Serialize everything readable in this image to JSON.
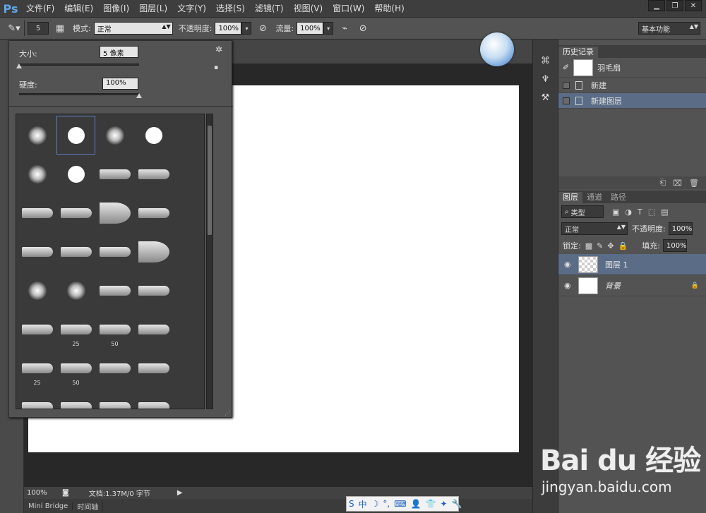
{
  "app": {
    "logo": "Ps"
  },
  "menu": [
    "文件(F)",
    "编辑(E)",
    "图像(I)",
    "图层(L)",
    "文字(Y)",
    "选择(S)",
    "滤镜(T)",
    "视图(V)",
    "窗口(W)",
    "帮助(H)"
  ],
  "window_controls": [
    "▁",
    "❐",
    "✕"
  ],
  "options_bar": {
    "brush_size": "5",
    "mode_label": "模式:",
    "mode_value": "正常",
    "opacity_label": "不透明度:",
    "opacity_value": "100%",
    "flow_label": "流量:",
    "flow_value": "100%",
    "workspace": "基本功能"
  },
  "brush_picker": {
    "size_label": "大小:",
    "size_value": "5 像素",
    "hardness_label": "硬度:",
    "hardness_value": "100%",
    "size_level": 0.0,
    "hardness_level": 1.0,
    "brushes": [
      {
        "kind": "soft"
      },
      {
        "kind": "hard",
        "selected": true
      },
      {
        "kind": "soft"
      },
      {
        "kind": "hard"
      },
      {
        "kind": "soft"
      },
      {
        "kind": "hard"
      },
      {
        "kind": "tip"
      },
      {
        "kind": "flat"
      },
      {
        "kind": "flat"
      },
      {
        "kind": "flat"
      },
      {
        "kind": "fan"
      },
      {
        "kind": "flat"
      },
      {
        "kind": "flat"
      },
      {
        "kind": "flat"
      },
      {
        "kind": "flat"
      },
      {
        "kind": "fan"
      },
      {
        "kind": "soft"
      },
      {
        "kind": "soft"
      },
      {
        "kind": "flat"
      },
      {
        "kind": "flat"
      },
      {
        "kind": "pencil"
      },
      {
        "kind": "pencil",
        "number": "25"
      },
      {
        "kind": "airbrush",
        "number": "50"
      },
      {
        "kind": "airbrush"
      },
      {
        "kind": "airbrush",
        "number": "25"
      },
      {
        "kind": "airbrush",
        "number": "50"
      },
      {
        "kind": "airbrush"
      },
      {
        "kind": "airbrush"
      },
      {
        "kind": "airbrush"
      },
      {
        "kind": "airbrush"
      },
      {
        "kind": "flat"
      },
      {
        "kind": "airbrush"
      }
    ]
  },
  "history_panel": {
    "tab": "历史记录",
    "snapshot": "羽毛扇",
    "items": [
      {
        "label": "新建",
        "selected": false
      },
      {
        "label": "新建图层",
        "selected": true
      }
    ]
  },
  "layers_panel": {
    "tabs": [
      "图层",
      "通道",
      "路径"
    ],
    "filter": "类型",
    "blend_mode": "正常",
    "opacity_label": "不透明度:",
    "opacity_value": "100%",
    "lock_label": "锁定:",
    "fill_label": "填充:",
    "fill_value": "100%",
    "layers": [
      {
        "name": "图层 1",
        "selected": true,
        "transparent": true
      },
      {
        "name": "背景",
        "selected": false,
        "transparent": false,
        "locked": true
      }
    ]
  },
  "status": {
    "zoom": "100%",
    "doc": "文档:1.37M/0 字节"
  },
  "bottom_tabs": [
    "Mini Bridge",
    "时间轴"
  ],
  "ime": [
    "S",
    "中",
    "☽",
    "°,",
    "⌨",
    "👤",
    "👕",
    "✦",
    "🔧"
  ],
  "watermark": {
    "main": "Bai du 经验",
    "sub": "jingyan.baidu.com"
  }
}
